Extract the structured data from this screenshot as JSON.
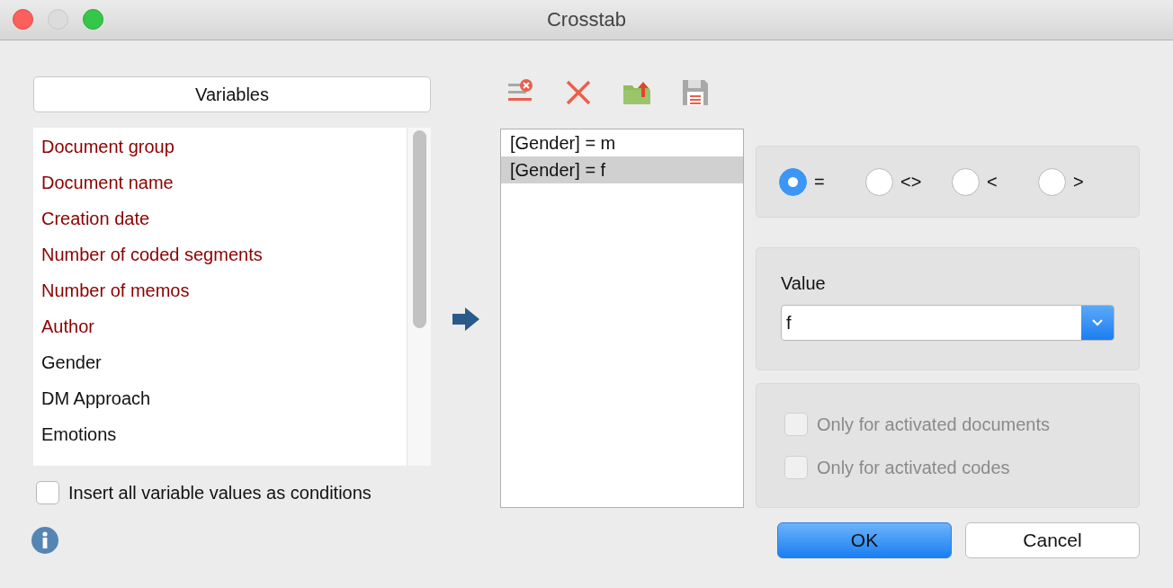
{
  "window": {
    "title": "Crosstab",
    "controls": [
      {
        "kind": "close"
      },
      {
        "kind": "minimize"
      },
      {
        "kind": "zoom"
      }
    ]
  },
  "variables": {
    "header": "Variables",
    "items": [
      {
        "label": "Document group",
        "kind": "system"
      },
      {
        "label": "Document name",
        "kind": "system"
      },
      {
        "label": "Creation date",
        "kind": "system"
      },
      {
        "label": "Number of coded segments",
        "kind": "system"
      },
      {
        "label": "Number of memos",
        "kind": "system"
      },
      {
        "label": "Author",
        "kind": "system"
      },
      {
        "label": "Gender",
        "kind": "user"
      },
      {
        "label": "DM Approach",
        "kind": "user"
      },
      {
        "label": "Emotions",
        "kind": "user"
      }
    ]
  },
  "insert_all": {
    "label": "Insert all variable values as conditions",
    "checked": false
  },
  "conditions": [
    {
      "label": "[Gender] = m",
      "selected": false
    },
    {
      "label": "[Gender] = f",
      "selected": true
    }
  ],
  "operators": [
    {
      "label": "=",
      "selected": true
    },
    {
      "label": "<>",
      "selected": false
    },
    {
      "label": "<",
      "selected": false
    },
    {
      "label": ">",
      "selected": false
    }
  ],
  "value": {
    "label": "Value",
    "value": "f"
  },
  "options": [
    {
      "label": "Only for activated documents",
      "checked": false,
      "disabled": true
    },
    {
      "label": "Only for activated codes",
      "checked": false,
      "disabled": true
    }
  ],
  "buttons": [
    {
      "label": "OK",
      "kind": "default"
    },
    {
      "label": "Cancel",
      "kind": "normal"
    }
  ]
}
